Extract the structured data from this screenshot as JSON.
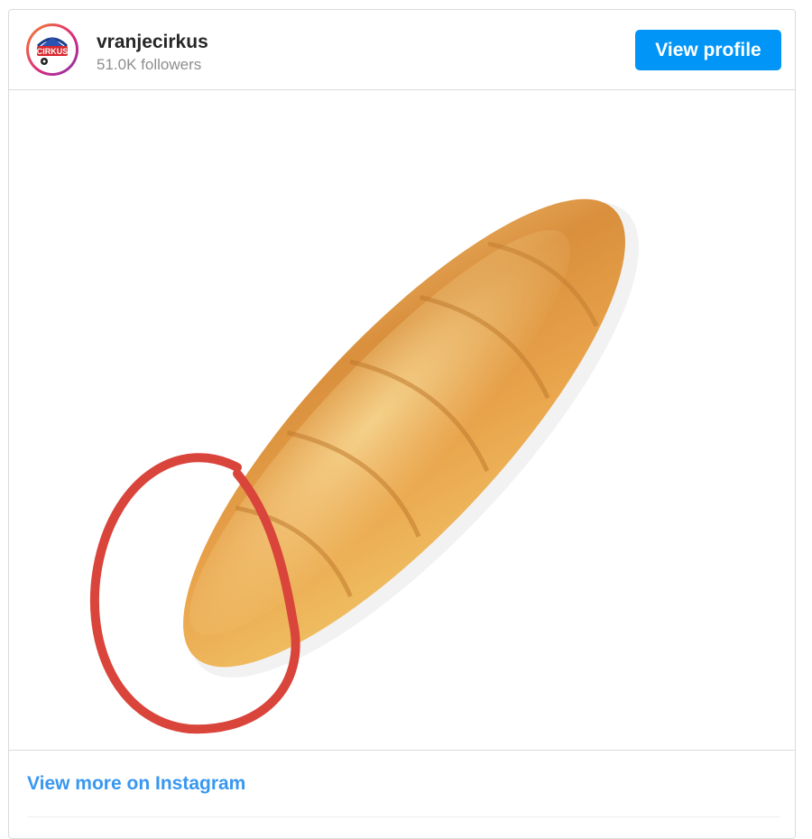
{
  "profile": {
    "username": "vranjecirkus",
    "followers": "51.0K followers",
    "avatar_text": "CIRKUS",
    "view_profile_label": "View profile"
  },
  "media": {
    "subject": "bread-loaf",
    "annotation": "red-circle",
    "annotation_color": "#d9443b"
  },
  "footer": {
    "view_more_label": "View more on Instagram"
  },
  "colors": {
    "accent": "#0095f6",
    "link": "#3897f0",
    "border": "#dbdbdb",
    "muted": "#8e8e8e"
  }
}
